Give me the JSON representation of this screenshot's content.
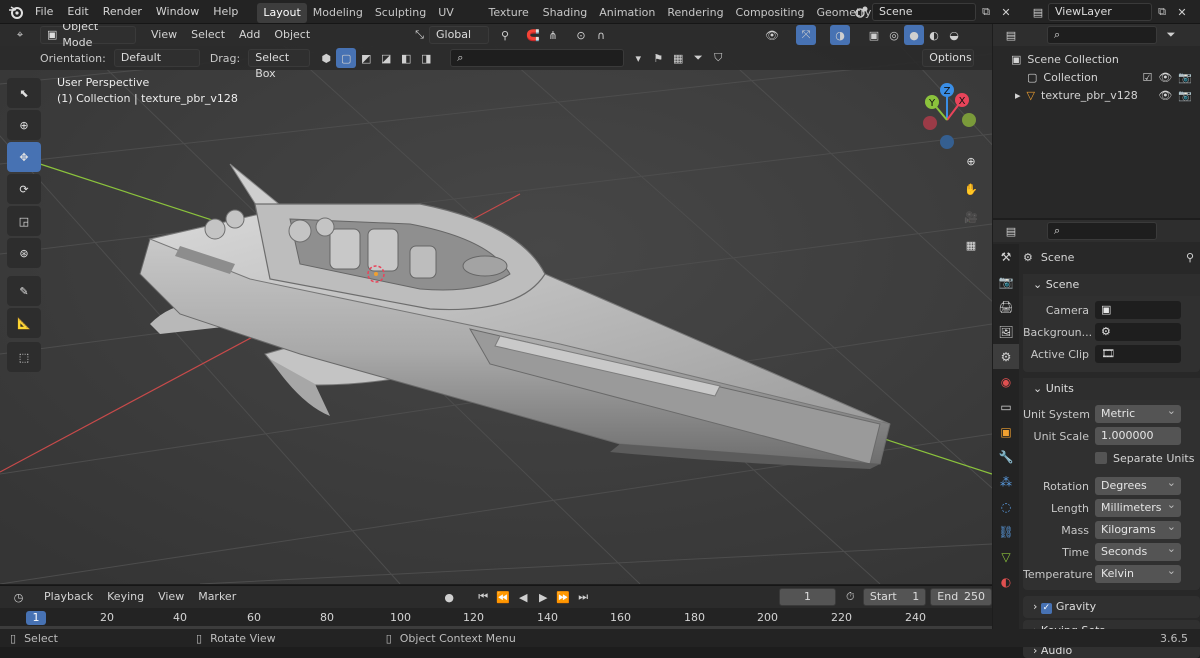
{
  "topbar": {
    "menus": [
      "File",
      "Edit",
      "Render",
      "Window",
      "Help"
    ],
    "workspaces": [
      "Layout",
      "Modeling",
      "Sculpting",
      "UV Editing",
      "Texture Paint",
      "Shading",
      "Animation",
      "Rendering",
      "Compositing",
      "Geometry Noc"
    ],
    "active_workspace": "Layout",
    "scene_name": "Scene",
    "view_layer": "ViewLayer"
  },
  "viewport": {
    "mode": "Object Mode",
    "header_menus": [
      "View",
      "Select",
      "Add",
      "Object"
    ],
    "transform_orientation": "Global",
    "orientation_label": "Orientation:",
    "orientation_value": "Default",
    "drag_label": "Drag:",
    "drag_value": "Select Box",
    "options_label": "Options",
    "overlay_title": "User Perspective",
    "overlay_subtitle": "(1) Collection | texture_pbr_v128",
    "gizmo_axes": [
      "Y",
      "X",
      "Z"
    ]
  },
  "outliner": {
    "items": [
      {
        "label": "Scene Collection"
      },
      {
        "label": "Collection"
      },
      {
        "label": "texture_pbr_v128"
      }
    ]
  },
  "properties": {
    "header": "Scene",
    "scene_panel": {
      "title": "Scene",
      "camera_label": "Camera",
      "background_label": "Backgroun...",
      "active_clip_label": "Active Clip"
    },
    "units_panel": {
      "title": "Units",
      "unit_system_label": "Unit System",
      "unit_system": "Metric",
      "unit_scale_label": "Unit Scale",
      "unit_scale": "1.000000",
      "separate_units_label": "Separate Units",
      "separate_units": false,
      "rotation_label": "Rotation",
      "rotation": "Degrees",
      "length_label": "Length",
      "length": "Millimeters",
      "mass_label": "Mass",
      "mass": "Kilograms",
      "time_label": "Time",
      "time": "Seconds",
      "temperature_label": "Temperature",
      "temperature": "Kelvin"
    },
    "collapsed_panels": [
      "Gravity",
      "Keying Sets",
      "Audio"
    ],
    "gravity_enabled": true
  },
  "timeline": {
    "menus": [
      "Playback",
      "Keying",
      "View",
      "Marker"
    ],
    "current_frame": "1",
    "start_label": "Start",
    "start": "1",
    "end_label": "End",
    "end": "250",
    "ruler": [
      1,
      20,
      40,
      60,
      80,
      100,
      120,
      140,
      160,
      180,
      200,
      220,
      240
    ]
  },
  "statusbar": {
    "select": "Select",
    "rotate": "Rotate View",
    "context": "Object Context Menu",
    "version": "3.6.5"
  },
  "colors": {
    "accent": "#4772b3",
    "axis_x": "#e8445a",
    "axis_y": "#8bc33c",
    "axis_z": "#3a8ee6"
  }
}
